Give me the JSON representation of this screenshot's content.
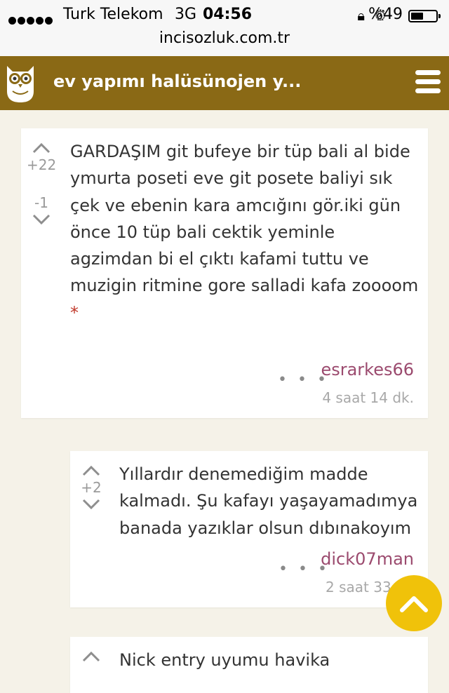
{
  "status_bar": {
    "carrier": "Turk Telekom",
    "network": "3G",
    "time": "04:56",
    "battery": "%49",
    "battery_level": 0.49,
    "url": "incisozluk.com.tr"
  },
  "header": {
    "title": "ev yapımı halüsünojen y...",
    "logo_icon": "owl-icon",
    "menu_icon": "hamburger-icon",
    "bg_color": "#8a6915"
  },
  "entries": [
    {
      "text": "GARDAŞIM git bufeye bir tüp bali al bide ymurta poseti eve git posete baliyi sık çek ve ebenin kara amcığını gör.iki gün önce 10 tüp bali cektik yeminle agzimdan bi el çıktı kafami tuttu ve muzigin ritmine gore salladi kafa zoooom",
      "star": "*",
      "upvotes": "+22",
      "downvotes": "-1",
      "more": "• • •",
      "author": "esrarkes66",
      "time": "4 saat 14 dk."
    },
    {
      "text": "Yıllardır denemediğim madde kalmadı. Şu kafayı yaşayamadımya banada yazıklar olsun dıbınakoyım",
      "upvotes": "+2",
      "more": "• • •",
      "author": "dick07man",
      "time": "2 saat 33"
    },
    {
      "text": "Nick entry uyumu havika"
    }
  ],
  "scroll_top_icon": "chevron-up-icon",
  "accent_color": "#f0c20a"
}
